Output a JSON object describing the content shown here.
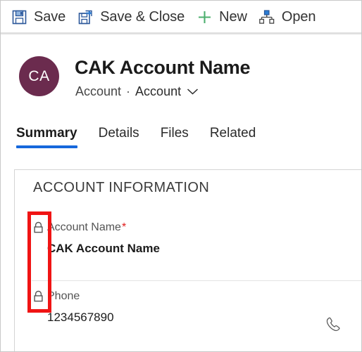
{
  "commandbar": {
    "buttons": [
      {
        "label": "Save",
        "icon": "save-icon"
      },
      {
        "label": "Save & Close",
        "icon": "save-and-close-icon"
      },
      {
        "label": "New",
        "icon": "plus-icon"
      },
      {
        "label": "Open",
        "icon": "hierarchy-icon"
      }
    ],
    "accent_green": "#4CAF6E",
    "accent_blue": "#2B7CD3"
  },
  "header": {
    "avatar_initials": "CA",
    "avatar_color": "#6B2B4E",
    "title": "CAK Account Name",
    "entity": "Account",
    "separator": "·",
    "form_name": "Account",
    "chevron": "chevron-down-icon"
  },
  "tabs": {
    "active_color": "#1668DC",
    "items": [
      {
        "label": "Summary",
        "active": true
      },
      {
        "label": "Details",
        "active": false
      },
      {
        "label": "Files",
        "active": false
      },
      {
        "label": "Related",
        "active": false
      }
    ]
  },
  "section": {
    "title": "ACCOUNT INFORMATION",
    "fields": [
      {
        "label": "Account Name",
        "required": true,
        "required_marker": "*",
        "locked": true,
        "lock_icon": "lock-icon",
        "value": "CAK Account Name",
        "value_bold": true,
        "trailing_icon": null
      },
      {
        "label": "Phone",
        "required": false,
        "required_marker": "",
        "locked": true,
        "lock_icon": "lock-icon",
        "value": "1234567890",
        "value_bold": false,
        "trailing_icon": "phone-icon"
      }
    ]
  },
  "annotation": {
    "type": "highlight-rectangle",
    "color": "#F01414",
    "target": "lock-icons-column"
  }
}
